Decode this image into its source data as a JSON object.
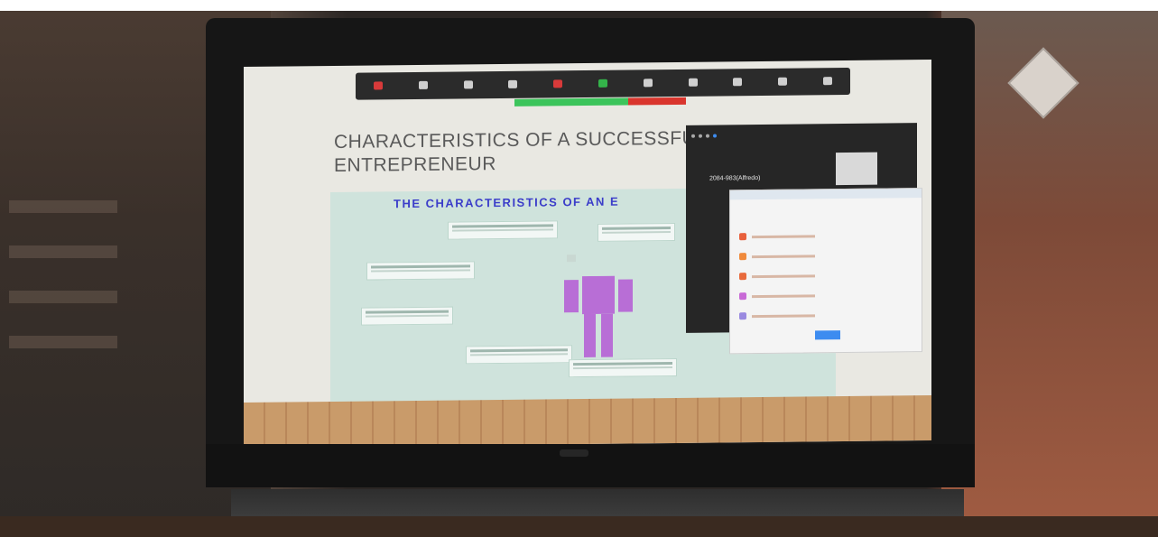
{
  "slide": {
    "title_line1": "CHARACTERISTICS OF A SUCCESSFUL",
    "title_line2": "ENTREPRENEUR",
    "image_title": "THE CHARACTERISTICS OF AN E"
  },
  "zoom": {
    "participant_name": "2084-983(Alfredo)"
  },
  "colors": {
    "toolbar_bg": "#2b2b2b",
    "figure_purple": "#b86ed6",
    "slide_title": "#5a5a5a",
    "image_title": "#3b3dc9",
    "recording_green": "#3cc45b",
    "stop_red": "#d9352d"
  },
  "icons": [
    "mic-icon",
    "video-icon",
    "security-icon",
    "participants-icon",
    "chat-icon",
    "share-icon",
    "pause-icon",
    "annotate-icon",
    "remote-control-icon",
    "end-icon",
    "more-icon"
  ]
}
